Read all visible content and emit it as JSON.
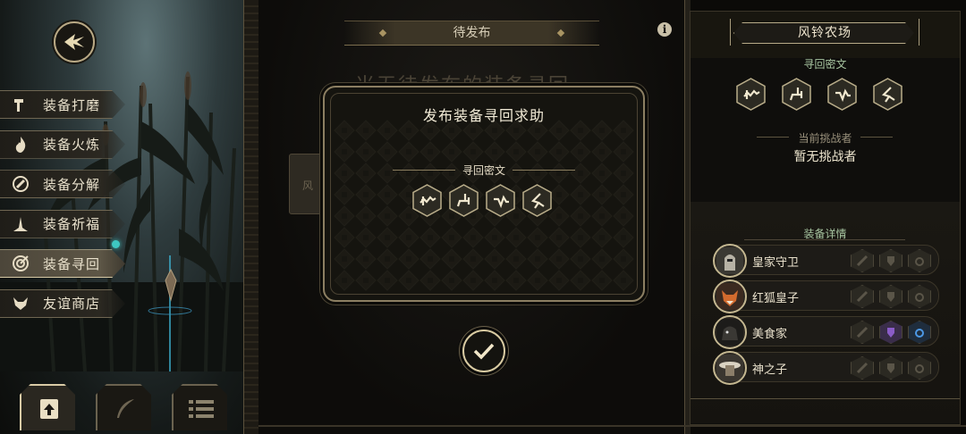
{
  "menu": {
    "items": [
      {
        "label": "装备打磨",
        "icon": "hammer-icon"
      },
      {
        "label": "装备火炼",
        "icon": "flame-icon"
      },
      {
        "label": "装备分解",
        "icon": "disassemble-icon"
      },
      {
        "label": "装备祈福",
        "icon": "pray-icon"
      },
      {
        "label": "装备寻回",
        "icon": "retrieve-icon",
        "active": true
      },
      {
        "label": "友谊商店",
        "icon": "fox-shop-icon"
      }
    ]
  },
  "main": {
    "tab_title": "待发布",
    "faded_heading": "当无待发布的装备寻回",
    "faded_card_text": "风"
  },
  "modal": {
    "title": "发布装备寻回求助",
    "cipher_label": "寻回密文",
    "glyphs": [
      "glyph-1-icon",
      "glyph-2-icon",
      "glyph-3-icon",
      "glyph-4-icon"
    ]
  },
  "right": {
    "farm_name": "风铃农场",
    "cipher_label": "寻回密文",
    "challenger_label": "当前挑战者",
    "challenger_value": "暂无挑战者",
    "equip_label": "装备详情",
    "equip_rows": [
      {
        "name": "皇家守卫",
        "slots": [
          "sword-slot-icon",
          "armor-slot-icon",
          "ring-slot-icon"
        ],
        "highlight": []
      },
      {
        "name": "红狐皇子",
        "slots": [
          "sword-slot-icon",
          "armor-slot-icon",
          "ring-slot-icon"
        ],
        "highlight": []
      },
      {
        "name": "美食家",
        "slots": [
          "sword-slot-icon",
          "armor-slot-icon",
          "ring-slot-icon"
        ],
        "highlight": [
          "armor",
          "ring"
        ]
      },
      {
        "name": "神之子",
        "slots": [
          "sword-slot-icon",
          "armor-slot-icon",
          "ring-slot-icon"
        ],
        "highlight": []
      }
    ]
  },
  "colors": {
    "gold": "#d9cba2",
    "accent_teal": "#3ec7c2",
    "purple_gear": "#7b4fb0",
    "blue_ring": "#3f86d6"
  }
}
